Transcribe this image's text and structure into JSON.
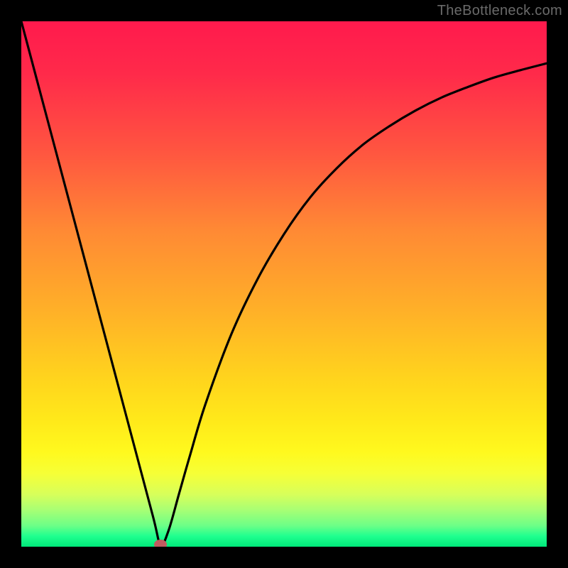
{
  "watermark": "TheBottleneck.com",
  "colors": {
    "frame_bg": "#000000",
    "curve_stroke": "#000000",
    "marker_fill": "#c15a60"
  },
  "chart_data": {
    "type": "line",
    "title": "",
    "xlabel": "",
    "ylabel": "",
    "xlim": [
      0,
      100
    ],
    "ylim": [
      0,
      100
    ],
    "x": [
      0,
      5,
      10,
      15,
      20,
      25,
      26.5,
      28,
      30,
      32,
      35,
      40,
      45,
      50,
      55,
      60,
      65,
      70,
      75,
      80,
      85,
      90,
      95,
      100
    ],
    "values": [
      100,
      81.2,
      62.4,
      43.6,
      24.8,
      6.0,
      0.4,
      3.0,
      10.0,
      17.0,
      27.0,
      40.5,
      51.0,
      59.5,
      66.5,
      72.0,
      76.5,
      80.0,
      83.0,
      85.5,
      87.5,
      89.3,
      90.7,
      92.0
    ],
    "marker": {
      "x": 26.5,
      "y": 0.4
    },
    "gradient_stops": [
      {
        "pos": 0.0,
        "color": "#ff1a4d"
      },
      {
        "pos": 0.25,
        "color": "#ff5640"
      },
      {
        "pos": 0.55,
        "color": "#ffb028"
      },
      {
        "pos": 0.82,
        "color": "#fff91e"
      },
      {
        "pos": 1.0,
        "color": "#00e87a"
      }
    ]
  }
}
